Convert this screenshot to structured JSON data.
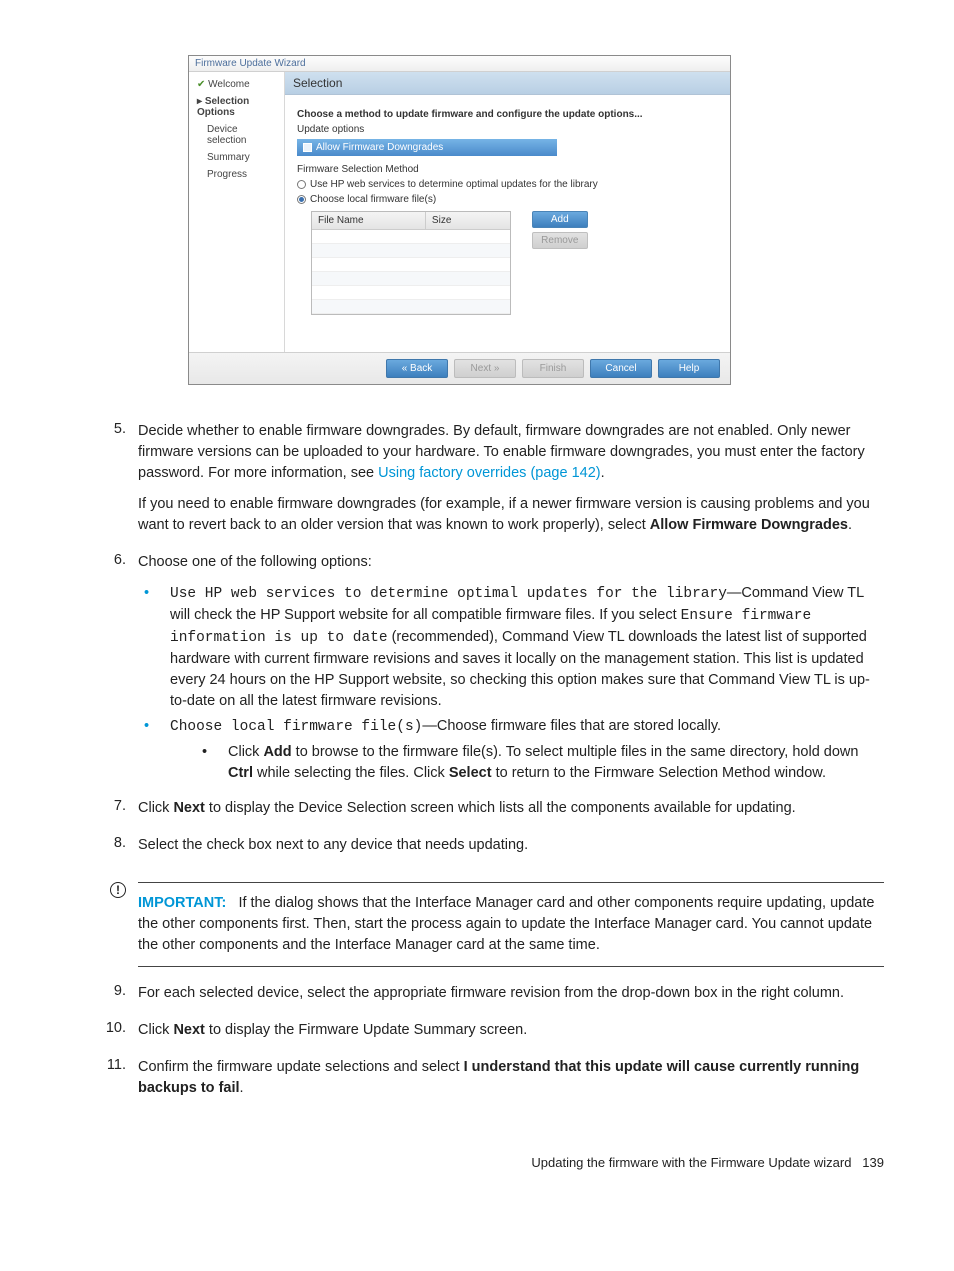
{
  "dialog": {
    "title": "Firmware Update Wizard",
    "sidebar": {
      "welcome": "Welcome",
      "selopts": "Selection Options",
      "devsel": "Device selection",
      "summary": "Summary",
      "progress": "Progress"
    },
    "panel_title": "Selection",
    "instr": "Choose a method to update firmware and configure the update options...",
    "update_opts": "Update options",
    "allow_dg": "Allow Firmware Downgrades",
    "fw_sel": "Firmware Selection Method",
    "radio_web": "Use HP web services to determine optimal updates for the library",
    "radio_local": "Choose local firmware file(s)",
    "col_name": "File Name",
    "col_size": "Size",
    "btn_add": "Add",
    "btn_remove": "Remove",
    "footer": {
      "back": "« Back",
      "next": "Next »",
      "finish": "Finish",
      "cancel": "Cancel",
      "help": "Help"
    }
  },
  "doc": {
    "step5": {
      "p1a": "Decide whether to enable firmware downgrades. By default, firmware downgrades are not enabled. Only newer firmware versions can be uploaded to your hardware. To enable firmware downgrades, you must enter the factory password. For more information, see ",
      "link": "Using factory overrides (page 142)",
      "p1b": ".",
      "p2a": "If you need to enable firmware downgrades (for example, if a newer firmware version is causing problems and you want to revert back to an older version that was known to work properly), select ",
      "p2bold": "Allow Firmware Downgrades",
      "p2b": "."
    },
    "step6": {
      "head": "Choose one of the following options:",
      "b1code": "Use HP web services to determine optimal updates for the library",
      "b1rest": "—Command View TL will check the HP Support website for all compatible firmware files. If you select ",
      "b1code2": "Ensure firmware information is up to date",
      "b1rest2": " (recommended), Command View TL downloads the latest list of supported hardware with current firmware revisions and saves it locally on the management station. This list is updated every 24 hours on the HP Support website, so checking this option makes sure that Command View TL is up-to-date on all the latest firmware revisions.",
      "b2code": "Choose local firmware file(s)",
      "b2rest": "—Choose firmware files that are stored locally.",
      "sub_a": "Click ",
      "sub_add": "Add",
      "sub_b": " to browse to the firmware file(s). To select multiple files in the same directory, hold down ",
      "sub_ctrl": "Ctrl",
      "sub_c": " while selecting the files. Click ",
      "sub_select": "Select",
      "sub_d": " to return to the Firmware Selection Method window."
    },
    "step7": {
      "a": "Click ",
      "next": "Next",
      "b": " to display the Device Selection screen which lists all the components available for updating."
    },
    "step8": "Select the check box next to any device that needs updating.",
    "important": {
      "label": "IMPORTANT:",
      "text": "If the dialog shows that the Interface Manager card and other components require updating, update the other components first. Then, start the process again to update the Interface Manager card. You cannot update the other components and the Interface Manager card at the same time."
    },
    "step9": "For each selected device, select the appropriate firmware revision from the drop-down box in the right column.",
    "step10": {
      "a": "Click ",
      "next": "Next",
      "b": " to display the Firmware Update Summary screen."
    },
    "step11": {
      "a": "Confirm the firmware update selections and select ",
      "bold": "I understand that this update will cause currently running backups to fail",
      "b": "."
    }
  },
  "nums": {
    "n5": "5.",
    "n6": "6.",
    "n7": "7.",
    "n8": "8.",
    "n9": "9.",
    "n10": "10.",
    "n11": "11."
  },
  "footer": {
    "text": "Updating the firmware with the Firmware Update wizard",
    "page": "139"
  }
}
